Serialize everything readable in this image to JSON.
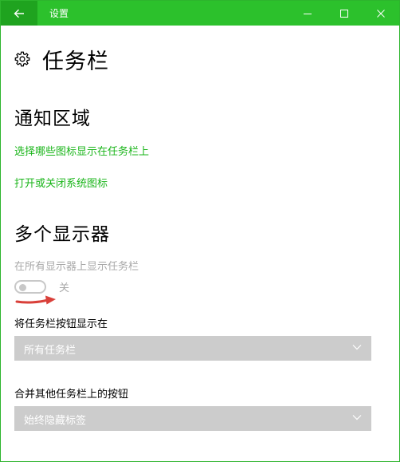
{
  "window": {
    "title": "设置"
  },
  "page": {
    "title": "任务栏"
  },
  "notification_area": {
    "heading": "通知区域",
    "links": [
      "选择哪些图标显示在任务栏上",
      "打开或关闭系统图标"
    ]
  },
  "multiple_displays": {
    "heading": "多个显示器",
    "show_on_all_label": "在所有显示器上显示任务栏",
    "toggle_state": "关",
    "buttons_on_label": "将任务栏按钮显示在",
    "buttons_on_value": "所有任务栏",
    "combine_label": "合并其他任务栏上的按钮",
    "combine_value": "始终隐藏标签"
  },
  "icons": {
    "back": "back-arrow-icon",
    "minimize": "minimize-icon",
    "maximize": "maximize-icon",
    "close": "close-icon",
    "page": "gear-icon",
    "dropdown": "chevron-down-icon"
  },
  "colors": {
    "accent": "#2cc12c",
    "link": "#1ab51a",
    "annotation_arrow": "#d9403a"
  }
}
